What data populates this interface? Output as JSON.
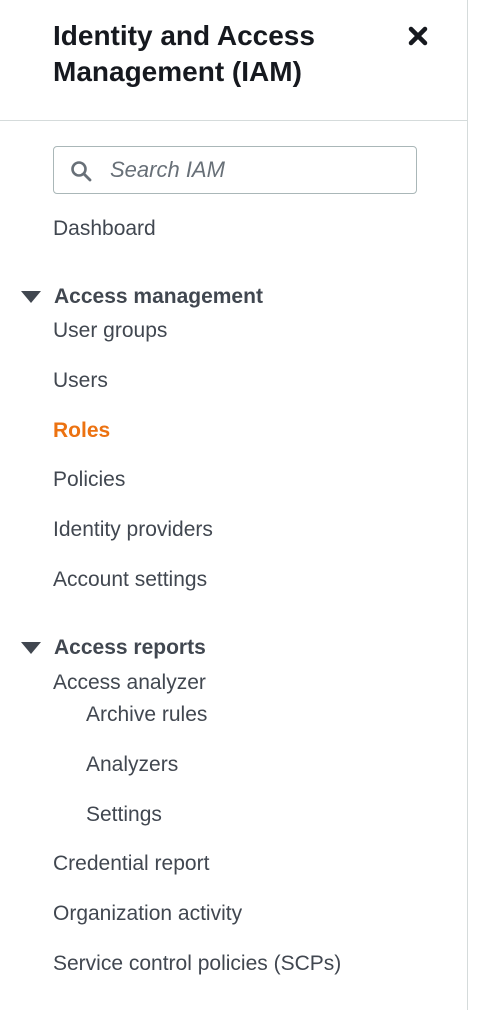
{
  "header": {
    "title": "Identity and Access Management (IAM)",
    "close_icon": "close-icon"
  },
  "search": {
    "placeholder": "Search IAM",
    "value": "",
    "icon": "search-icon"
  },
  "nav": {
    "dashboard": "Dashboard",
    "access_management": {
      "label": "Access management",
      "expanded": true,
      "items": [
        "User groups",
        "Users",
        "Roles",
        "Policies",
        "Identity providers",
        "Account settings"
      ],
      "active": "Roles"
    },
    "access_reports": {
      "label": "Access reports",
      "expanded": true,
      "analyzer": {
        "label": "Access analyzer",
        "subitems": [
          "Archive rules",
          "Analyzers",
          "Settings"
        ]
      },
      "items": [
        "Credential report",
        "Organization activity",
        "Service control policies (SCPs)"
      ]
    }
  },
  "colors": {
    "active": "#ec7211",
    "text": "#414750",
    "border": "#d5dbdb"
  }
}
